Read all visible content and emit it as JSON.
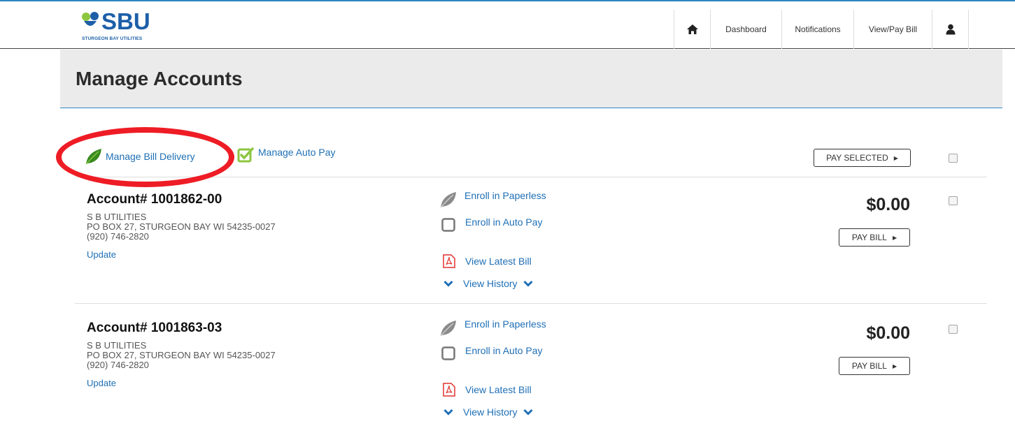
{
  "header": {
    "logo": {
      "wordmark": "SBU",
      "tagline": "STURGEON BAY UTILITIES"
    },
    "nav": {
      "home_icon": "home-icon",
      "dashboard": "Dashboard",
      "notifications": "Notifications",
      "view_pay_bill": "View/Pay Bill",
      "user_icon": "user-icon"
    }
  },
  "page": {
    "title": "Manage Accounts"
  },
  "toolbar": {
    "manage_bill_delivery": "Manage Bill Delivery",
    "manage_auto_pay": "Manage Auto Pay",
    "pay_selected": "PAY SELECTED"
  },
  "accounts": [
    {
      "title": "Account# 1001862-00",
      "name": "S B UTILITIES",
      "address": "PO BOX 27, STURGEON BAY WI 54235-0027",
      "phone": "(920) 746-2820",
      "update": "Update",
      "enroll_paperless": "Enroll in Paperless",
      "enroll_autopay": "Enroll in Auto Pay",
      "view_latest_bill": "View Latest Bill",
      "view_history": "View History",
      "amount": "$0.00",
      "pay_bill": "PAY BILL"
    },
    {
      "title": "Account# 1001863-03",
      "name": "S B UTILITIES",
      "address": "PO BOX 27, STURGEON BAY WI 54235-0027",
      "phone": "(920) 746-2820",
      "update": "Update",
      "enroll_paperless": "Enroll in Paperless",
      "enroll_autopay": "Enroll in Auto Pay",
      "view_latest_bill": "View Latest Bill",
      "view_history": "View History",
      "amount": "$0.00",
      "pay_bill": "PAY BILL"
    }
  ],
  "colors": {
    "accent_blue": "#1e6fb5",
    "highlight_ellipse": "#ee1c25",
    "leaf_green": "#3a8a1f",
    "autopay_green": "#8cc63f",
    "pdf_red": "#e0312d"
  }
}
